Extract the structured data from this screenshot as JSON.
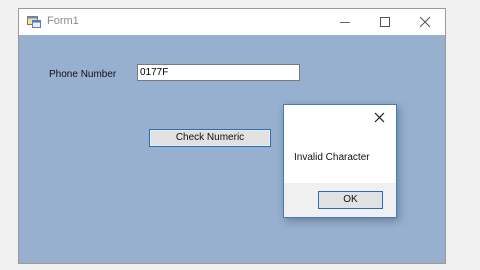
{
  "window": {
    "title": "Form1",
    "minimize_icon": "minimize-icon",
    "maximize_icon": "maximize-icon",
    "close_icon": "close-icon",
    "app_icon": "form-app-icon",
    "client_color": "#97b0cf"
  },
  "form": {
    "phone_label": "Phone Number",
    "phone_value": "0177F",
    "check_button_label": "Check Numeric"
  },
  "message_box": {
    "text": "Invalid Character",
    "ok_label": "OK",
    "close_icon": "close-icon",
    "border_color": "#3e7cc4"
  }
}
